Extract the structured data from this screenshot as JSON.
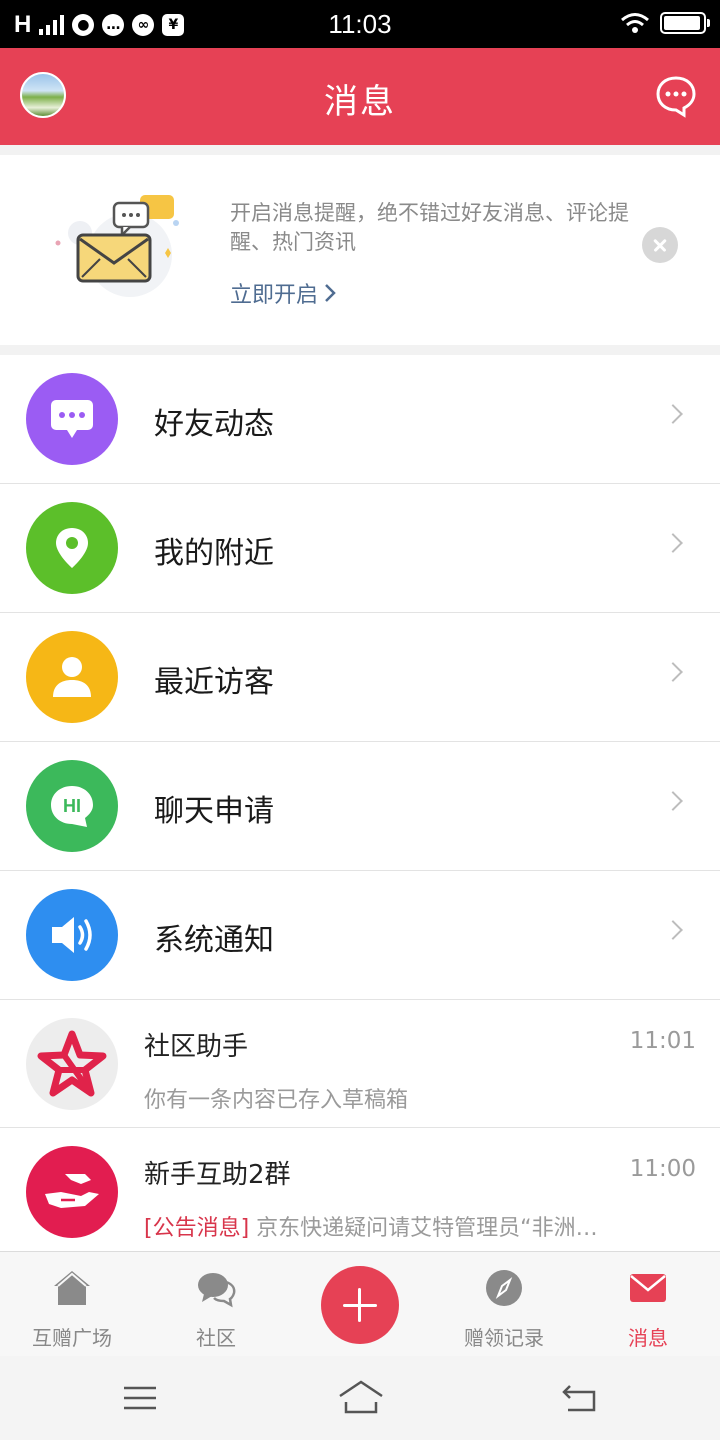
{
  "status_bar": {
    "network": "H",
    "time": "11:03",
    "battery_level": 0.95
  },
  "header": {
    "title": "消息"
  },
  "banner": {
    "text": "开启消息提醒，绝不错过好友消息、评论提醒、热门资讯",
    "link": "立即开启"
  },
  "menu": {
    "items": [
      {
        "label": "好友动态",
        "icon": "chat-bubble-icon",
        "color": "#9b5cf3"
      },
      {
        "label": "我的附近",
        "icon": "location-pin-icon",
        "color": "#5cbf2a"
      },
      {
        "label": "最近访客",
        "icon": "user-icon",
        "color": "#f6b716"
      },
      {
        "label": "聊天申请",
        "icon": "hi-bubble-icon",
        "color": "#3cb95b",
        "hi": "HI"
      },
      {
        "label": "系统通知",
        "icon": "speaker-icon",
        "color": "#2e8ef0"
      }
    ]
  },
  "chats": [
    {
      "name": "社区助手",
      "time": "11:01",
      "preview": "你有一条内容已存入草稿箱",
      "tag": "",
      "icon": "red-star-icon"
    },
    {
      "name": "新手互助2群",
      "time": "11:00",
      "tag": "[公告消息]",
      "preview": " 京东快递疑问请艾特管理员“非洲…",
      "icon": "helping-hand-icon"
    }
  ],
  "tabbar": {
    "items": [
      {
        "label": "互赠广场",
        "icon": "house-icon",
        "active": false
      },
      {
        "label": "社区",
        "icon": "chat-bubbles-icon",
        "active": false
      },
      {
        "label": "赠领记录",
        "icon": "compass-icon",
        "active": false
      },
      {
        "label": "消息",
        "icon": "mail-icon",
        "active": true
      }
    ]
  },
  "colors": {
    "accent": "#e64155",
    "link": "#4f6c91"
  }
}
